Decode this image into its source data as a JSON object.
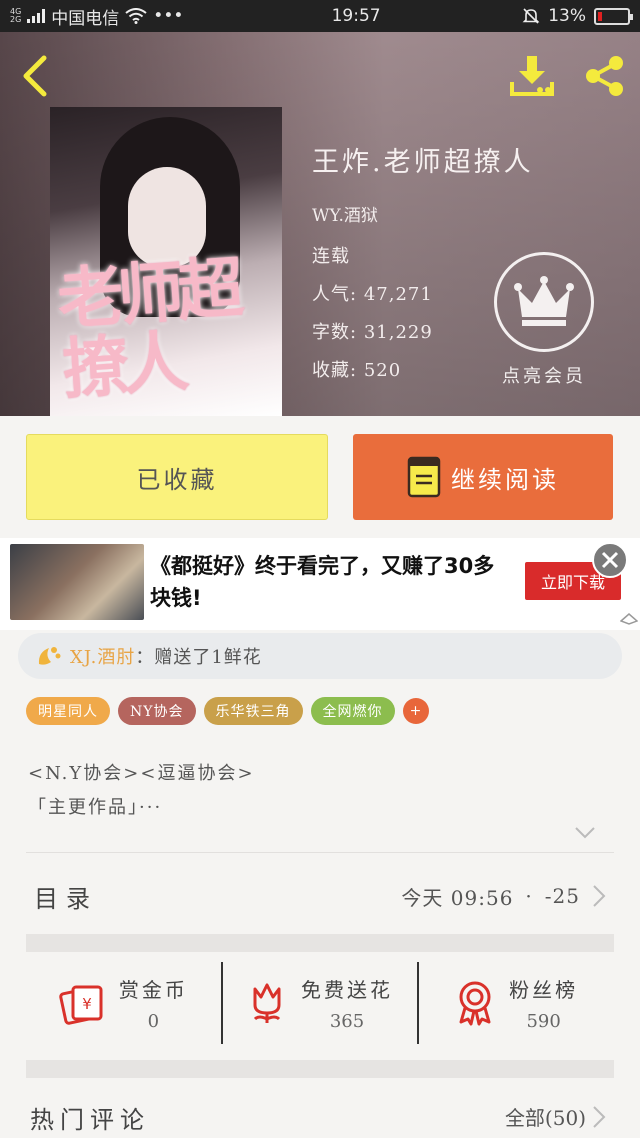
{
  "status_bar": {
    "network": "4G",
    "network2": "2G",
    "carrier": "中国电信",
    "dots": "•••",
    "time": "19:57",
    "battery_percent": "13%",
    "battery_level": 0.13
  },
  "book": {
    "title": "王炸.老师超撩人",
    "author": "WY.酒狱",
    "status": "连载",
    "popularity_label": "人气:",
    "popularity": "47,271",
    "word_count_label": "字数:",
    "word_count": "31,229",
    "favorites_label": "收藏:",
    "favorites": "520",
    "cover_title": "老师超撩人"
  },
  "member": {
    "label": "点亮会员"
  },
  "actions": {
    "collected": "已收藏",
    "continue_reading": "继续阅读"
  },
  "ad": {
    "text": "《都挺好》终于看完了，又赚了30多块钱!",
    "button": "立即下载"
  },
  "gift": {
    "user": "XJ.酒肘",
    "message": "：赠送了1鲜花"
  },
  "tags": [
    {
      "label": "明星同人",
      "color": "#f0a94a"
    },
    {
      "label": "NY协会",
      "color": "#b5655e"
    },
    {
      "label": "乐华铁三角",
      "color": "#c9a04a"
    },
    {
      "label": "全网燃你",
      "color": "#8cbd4e"
    }
  ],
  "tag_add": "+",
  "description": {
    "line1": "<N.Y协会><逗逼协会>",
    "line2": "「主更作品」···"
  },
  "catalog": {
    "label": "目录",
    "updated": "今天 09:56",
    "separator": "·",
    "count": "-25"
  },
  "stats": [
    {
      "label": "赏金币",
      "value": "0",
      "icon": "red-envelope-icon"
    },
    {
      "label": "免费送花",
      "value": "365",
      "icon": "flower-icon"
    },
    {
      "label": "粉丝榜",
      "value": "590",
      "icon": "medal-icon"
    }
  ],
  "comments": {
    "title": "热门评论",
    "all": "全部(50)"
  },
  "colors": {
    "accent_orange": "#e96d3c",
    "accent_yellow": "#faf27c",
    "icon_yellow": "#f7ea4b",
    "icon_red": "#d9312a"
  }
}
